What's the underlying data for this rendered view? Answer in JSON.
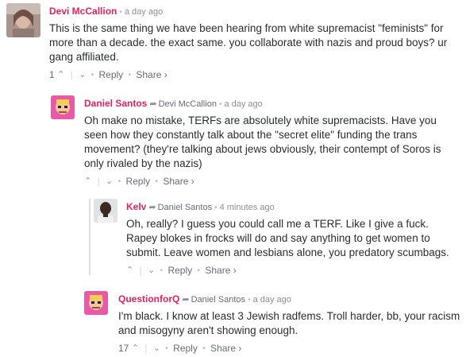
{
  "comments": [
    {
      "author": "Devi McCallion",
      "parent": "",
      "time": "a day ago",
      "text": "This is the same thing we have been hearing from white supremacist \"feminists\" for more than a decade. the exact same. you collaborate with nazis and proud boys? ur gang affiliated.",
      "votes": "1",
      "reply_label": "Reply",
      "share_label": "Share ›"
    },
    {
      "author": "Daniel Santos",
      "parent": "Devi McCallion",
      "time": "a day ago",
      "text": "Oh make no mistake, TERFs are absolutely white supremacists. Have you seen how they constantly talk about the \"secret elite\" funding the trans movement? (they're talking about jews obviously, their contempt of Soros is only rivaled by the nazis)",
      "votes": "",
      "reply_label": "Reply",
      "share_label": "Share ›"
    },
    {
      "author": "Kelv",
      "parent": "Daniel Santos",
      "time": "4 minutes ago",
      "text": "Oh, really? I guess you could call me a TERF. Like I give a fuck. Rapey blokes in frocks will do and say anything to get women to submit. Leave women and lesbians alone, you predatory scumbags.",
      "votes": "",
      "reply_label": "Reply",
      "share_label": "Share ›"
    },
    {
      "author": "QuestionforQ",
      "parent": "Daniel Santos",
      "time": "a day ago",
      "text": "I'm black. I know at least 3 Jewish radfems. Troll harder, bb, your racism and misogyny aren't showing enough.",
      "votes": "17",
      "reply_label": "Reply",
      "share_label": "Share ›"
    }
  ],
  "colors": {
    "author": "#e0245e",
    "meta": "#8a8f99",
    "text": "#2a2e2e",
    "thread_line": "#dbdfe4"
  }
}
